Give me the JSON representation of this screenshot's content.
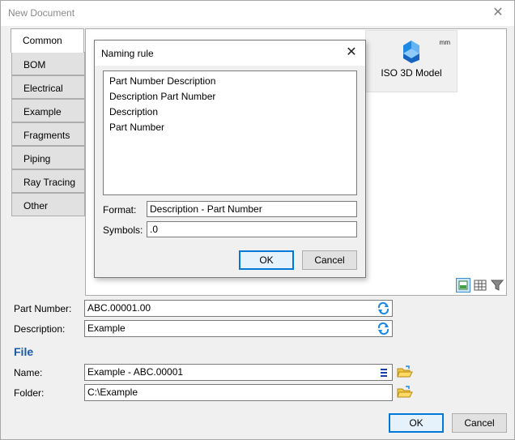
{
  "window": {
    "title": "New Document"
  },
  "tabs": [
    "Common",
    "BOM",
    "Electrical",
    "Example",
    "Fragments",
    "Piping",
    "Ray Tracing",
    "Other"
  ],
  "template": {
    "label": "ISO 3D Model",
    "unit": "mm"
  },
  "fields": {
    "part_number_label": "Part Number:",
    "part_number_value": "ABC.00001.00",
    "description_label": "Description:",
    "description_value": "Example"
  },
  "file": {
    "section_title": "File",
    "name_label": "Name:",
    "name_value": "Example - ABC.00001",
    "folder_label": "Folder:",
    "folder_value": "C:\\Example"
  },
  "buttons": {
    "ok": "OK",
    "cancel": "Cancel"
  },
  "dialog": {
    "title": "Naming rule",
    "options": [
      "Part Number Description",
      "Description Part Number",
      "Description",
      "Part Number"
    ],
    "format_label": "Format:",
    "format_value": "Description - Part Number",
    "symbols_label": "Symbols:",
    "symbols_value": ".0",
    "ok": "OK",
    "cancel": "Cancel"
  },
  "icons": {
    "close": "close-icon",
    "template": "iso-3d-model-icon",
    "refresh": "refresh-icon",
    "list": "list-icon",
    "folder": "folder-open-icon",
    "view_large": "large-icons-view-icon",
    "view_grid": "grid-view-icon",
    "filter": "filter-icon"
  },
  "colors": {
    "accent": "#0078d7",
    "section": "#1a5aa8",
    "window_bg": "#f0f0f0"
  }
}
